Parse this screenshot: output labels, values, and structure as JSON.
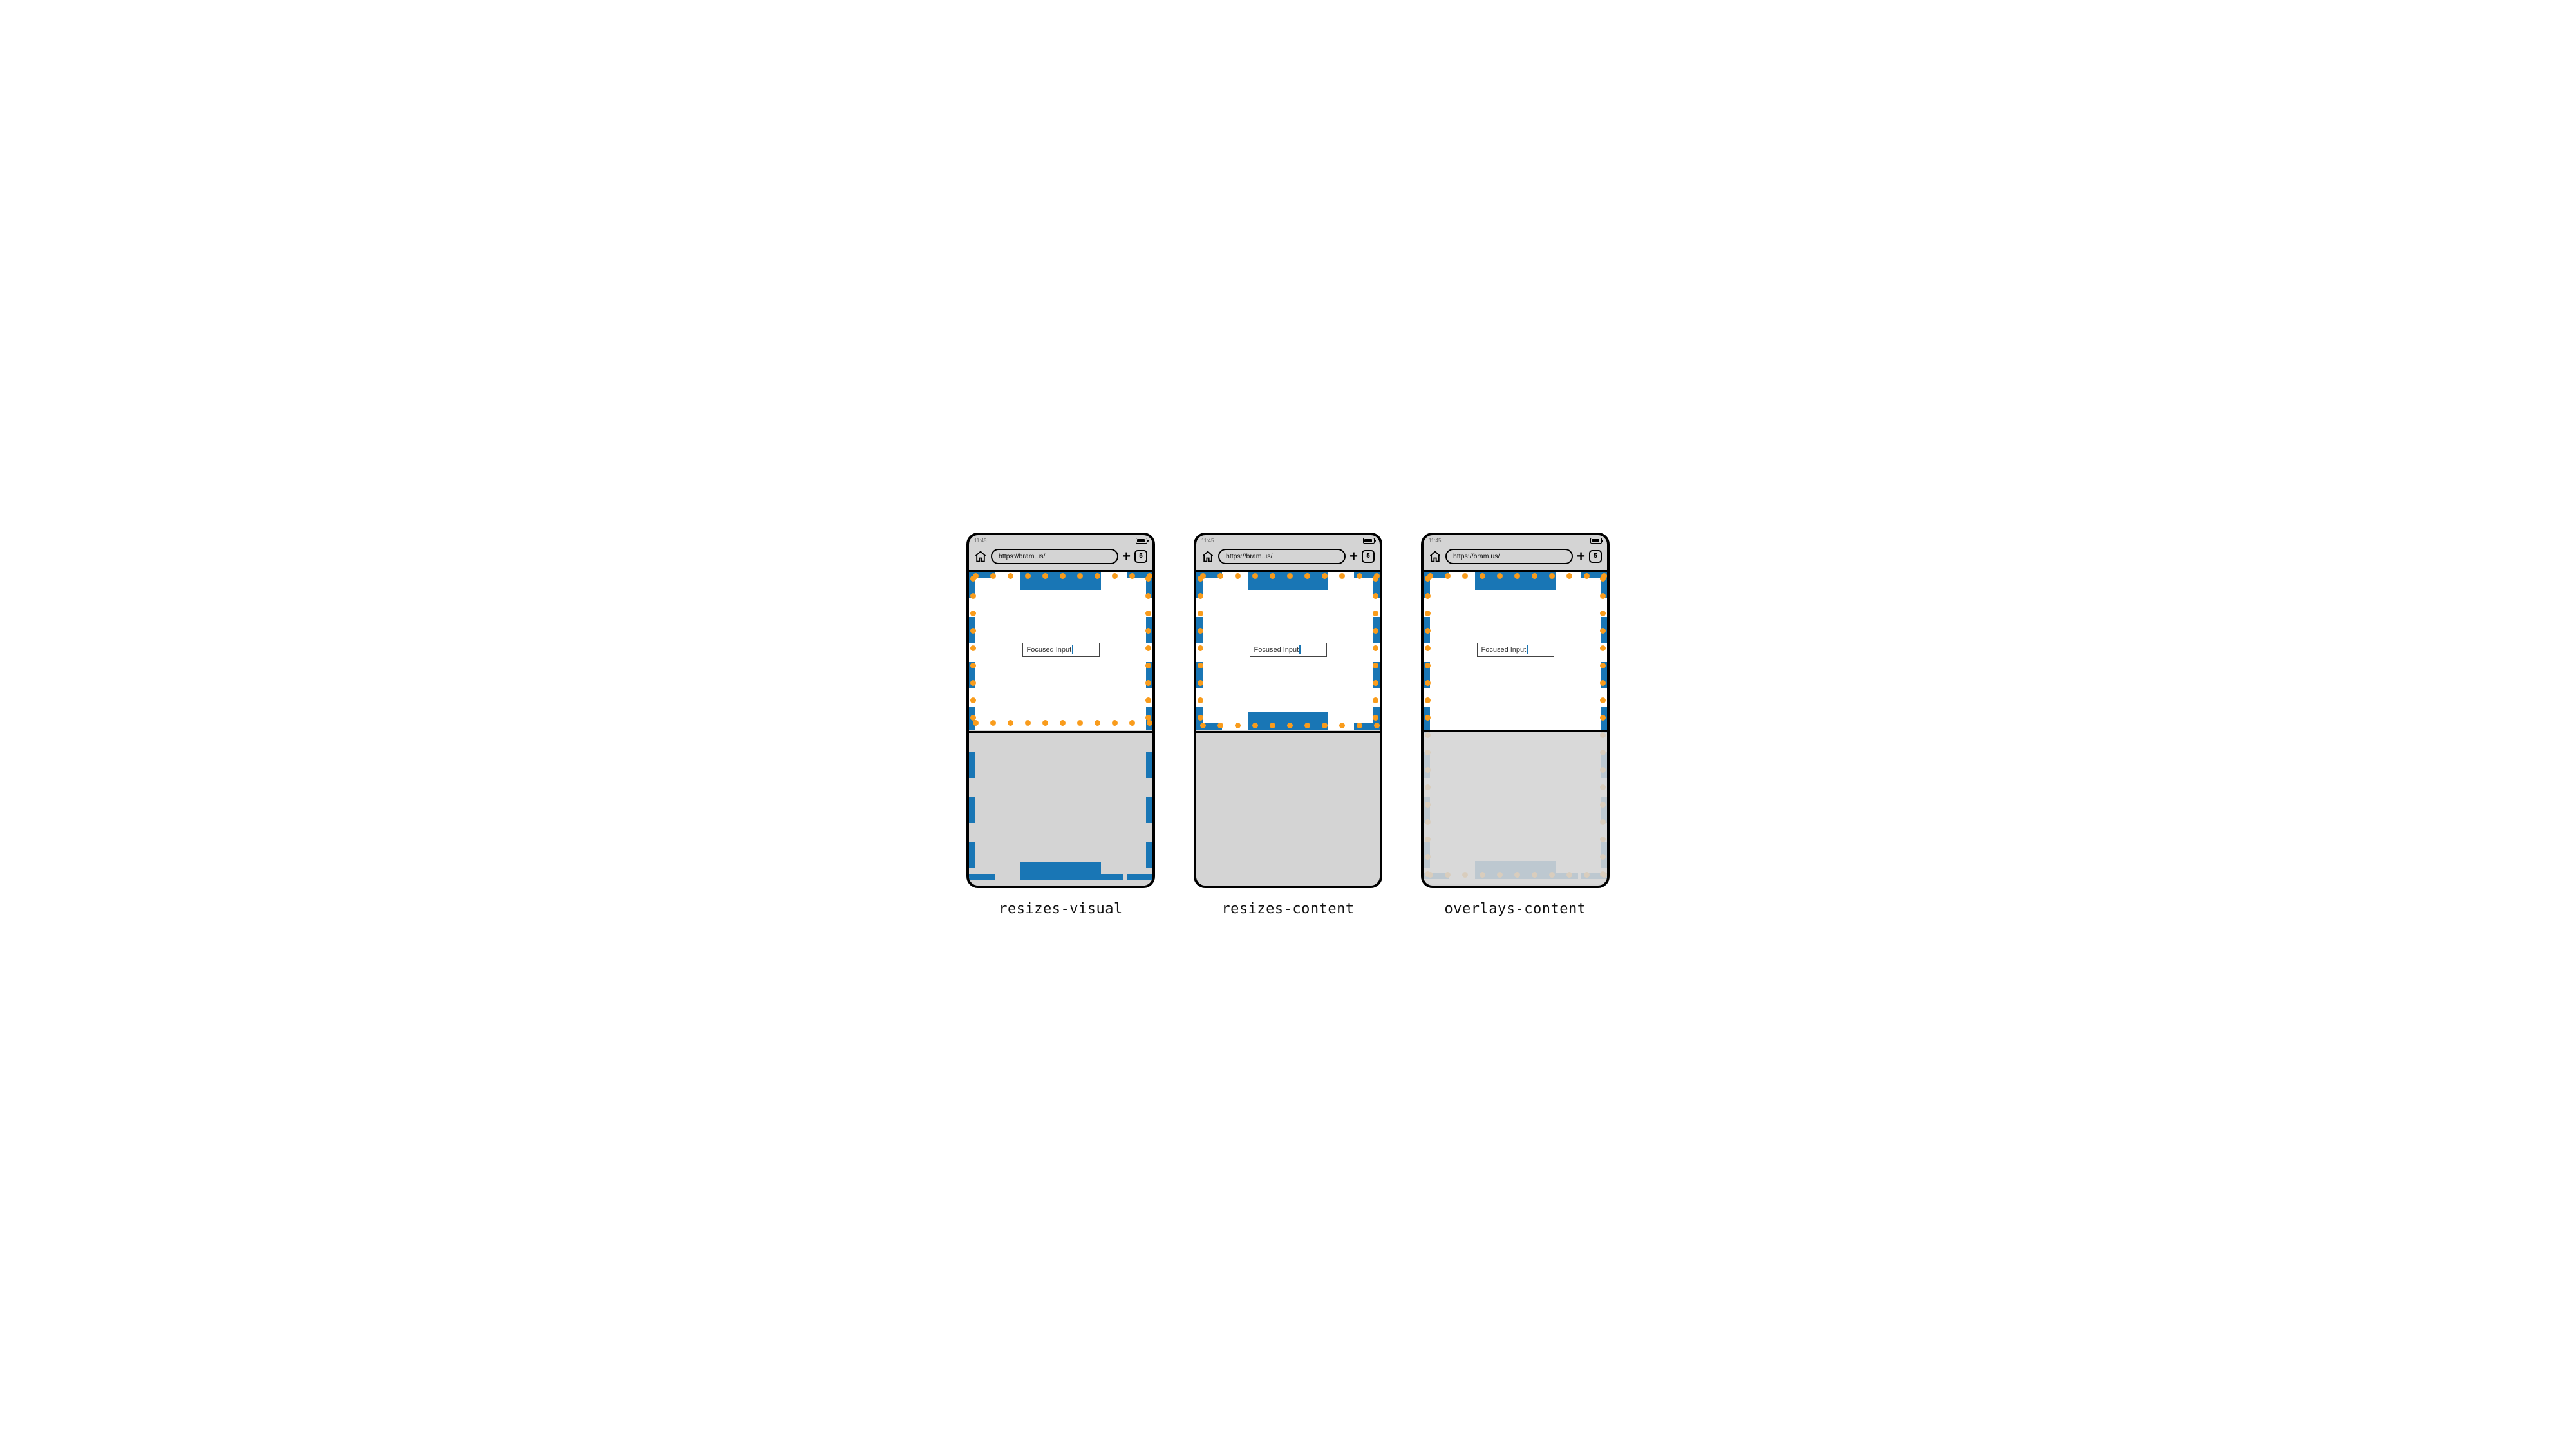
{
  "status_time": "11:45",
  "url": "https://bram.us/",
  "tab_count": "5",
  "input_value": "Focused Input",
  "captions": {
    "p1": "resizes-visual",
    "p2": "resizes-content",
    "p3": "overlays-content"
  },
  "colors": {
    "blue": "#1976b5",
    "orange": "#f99c1c",
    "chrome": "#d4d4d4"
  }
}
